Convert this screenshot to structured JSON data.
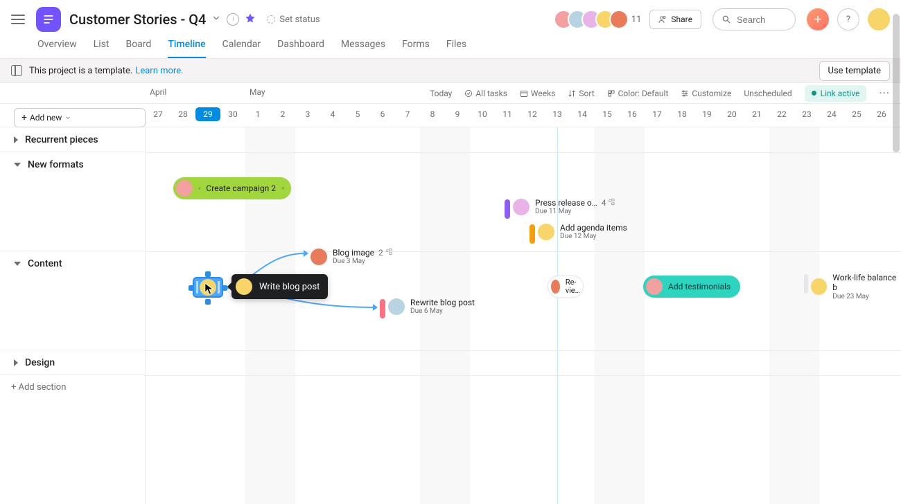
{
  "header": {
    "title": "Customer Stories - Q4",
    "set_status": "Set status",
    "member_count": "11",
    "share": "Share",
    "search_placeholder": "Search"
  },
  "tabs": [
    "Overview",
    "List",
    "Board",
    "Timeline",
    "Calendar",
    "Dashboard",
    "Messages",
    "Forms",
    "Files"
  ],
  "active_tab": "Timeline",
  "banner": {
    "text": "This project is a template.",
    "link": "Learn more.",
    "button": "Use template"
  },
  "toolbar": {
    "add_new": "Add new",
    "months": {
      "april": "April",
      "may": "May"
    },
    "today": "Today",
    "all_tasks": "All tasks",
    "weeks": "Weeks",
    "sort": "Sort",
    "color": "Color: Default",
    "customize": "Customize",
    "unscheduled": "Unscheduled",
    "link_active": "Link active"
  },
  "dates": [
    "27",
    "28",
    "29",
    "30",
    "1",
    "2",
    "3",
    "4",
    "5",
    "6",
    "7",
    "8",
    "9",
    "10",
    "11",
    "12",
    "13",
    "14",
    "15",
    "16",
    "17",
    "18",
    "19",
    "20",
    "21",
    "22",
    "23",
    "24",
    "25",
    "26"
  ],
  "today_index": 2,
  "sections": {
    "recurrent": "Recurrent pieces",
    "new_formats": "New formats",
    "content": "Content",
    "design": "Design",
    "add_section": "+ Add section"
  },
  "tasks": {
    "campaign": {
      "label": "Create campaign",
      "count": "2"
    },
    "press": {
      "label": "Press release o…",
      "count": "4",
      "due": "Due 11 May"
    },
    "agenda": {
      "label": "Add agenda items",
      "due": "Due 12 May"
    },
    "blogimg": {
      "label": "Blog image",
      "count": "2",
      "due": "Due 3 May"
    },
    "writeblog": {
      "label": "Write blog post"
    },
    "rewrite": {
      "label": "Rewrite blog post",
      "due": "Due 6 May"
    },
    "review": {
      "label": "Re-vie…"
    },
    "testi": {
      "label": "Add testimonials"
    },
    "worklife": {
      "label": "Work-life balance b",
      "due": "Due 23 May"
    }
  },
  "colors": {
    "campaign_bg": "#a2d63d",
    "press_marker": "#8b5cf6",
    "agenda_marker": "#f59e0b",
    "rewrite_marker": "#fb7185",
    "testi_bg": "#14b8a6",
    "selected": "#4aa7ff"
  }
}
